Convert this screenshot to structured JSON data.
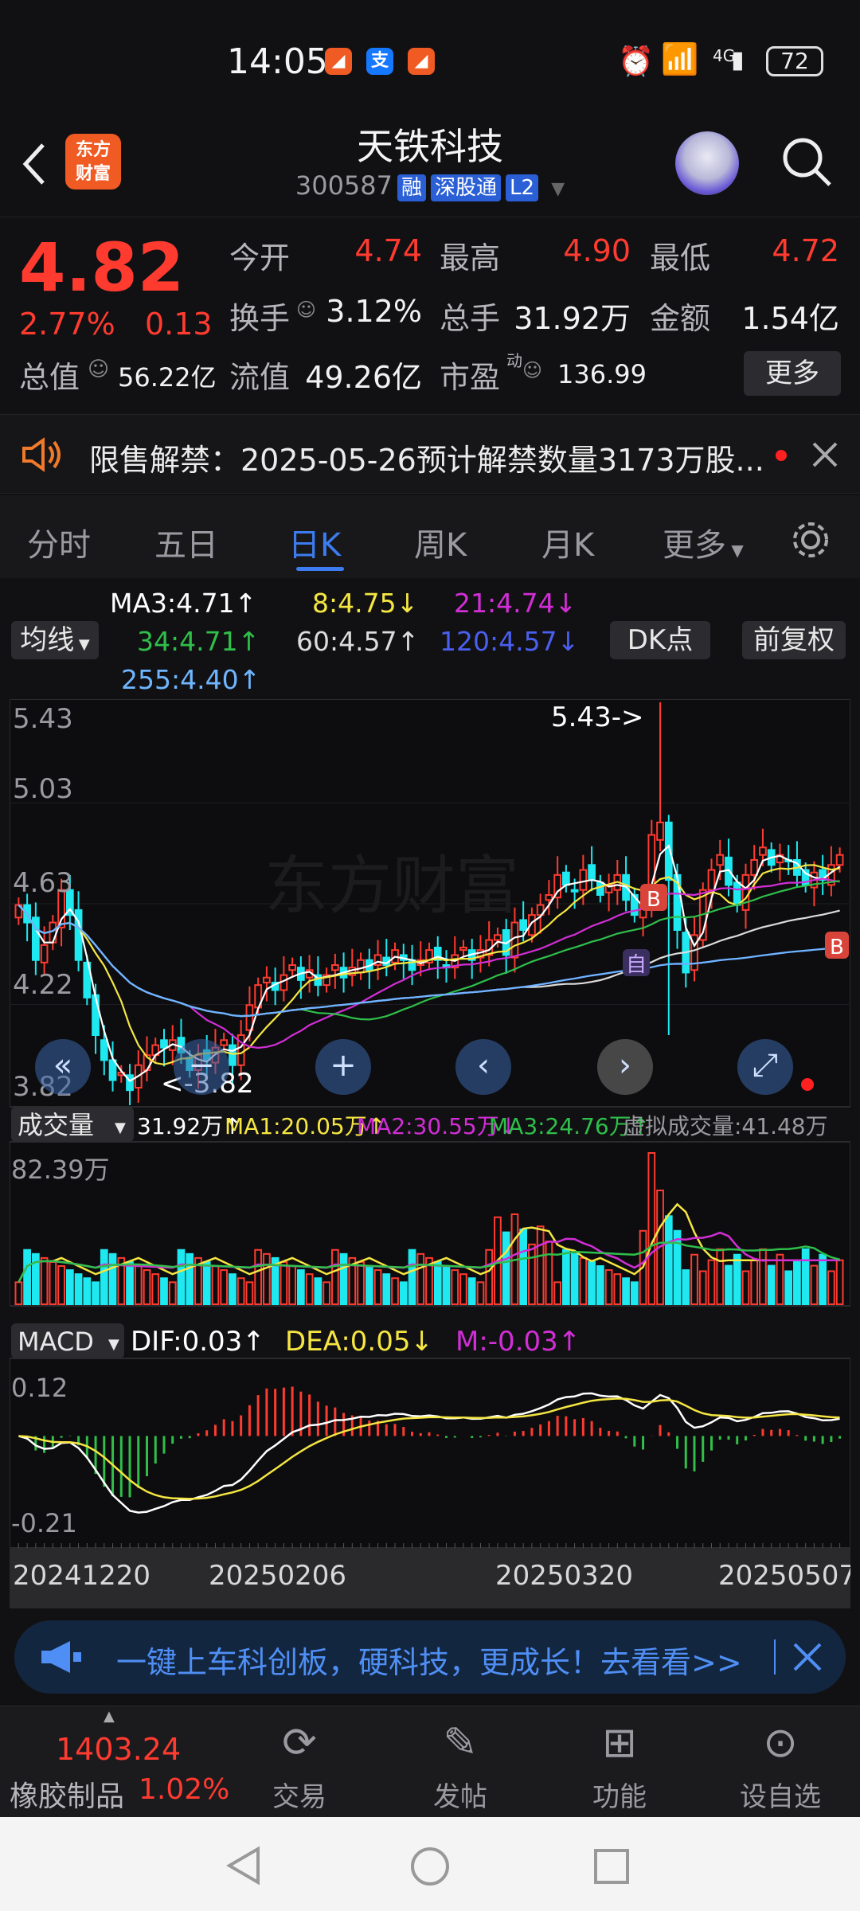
{
  "status_bar": {
    "time": "14:05",
    "battery": "72",
    "network": "4G"
  },
  "header": {
    "logo_line1": "东方",
    "logo_line2": "财富",
    "title": "天铁科技",
    "code": "300587",
    "tags": [
      "融",
      "深股通",
      "L2"
    ]
  },
  "quote": {
    "price": "4.82",
    "change_pct": "2.77%",
    "change": "0.13",
    "open_label": "今开",
    "open": "4.74",
    "high_label": "最高",
    "high": "4.90",
    "low_label": "最低",
    "low": "4.72",
    "turnover_label": "换手",
    "turnover": "3.12%",
    "volume_label": "总手",
    "volume": "31.92万",
    "amount_label": "金额",
    "amount": "1.54亿",
    "mcap_label": "总值",
    "mcap": "56.22亿",
    "float_label": "流值",
    "float_cap": "49.26亿",
    "pe_label": "市盈",
    "pe_sup": "动",
    "pe": "136.99",
    "more": "更多"
  },
  "notice": {
    "text": "限售解禁：2025-05-26预计解禁数量3173万股..."
  },
  "tabs": [
    "分时",
    "五日",
    "日K",
    "周K",
    "月K",
    "更多"
  ],
  "active_tab": 2,
  "ma_legend": {
    "ma3": "MA3:4.71↑",
    "ma8": "8:4.75↓",
    "ma21": "21:4.74↓",
    "ma34": "34:4.71↑",
    "ma60": "60:4.57↑",
    "ma120": "120:4.57↓",
    "ma255": "255:4.40↑",
    "selector": "均线",
    "dk": "DK点",
    "fq": "前复权"
  },
  "colors": {
    "up": "#ff3b30",
    "down": "#1ee8f0",
    "ma3": "#ffffff",
    "ma8": "#f5e642",
    "ma21": "#d22ed6",
    "ma34": "#2fbf4a",
    "ma60": "#dcdcdc",
    "ma120": "#4a5ff0",
    "ma255": "#6fb5ff",
    "accent": "#3d7cf0"
  },
  "kline": {
    "y_labels": [
      "5.43",
      "5.03",
      "4.63",
      "4.22",
      "3.82"
    ],
    "max_label": "5.43->",
    "min_label": "<-3.82",
    "markers": [
      "B",
      "B",
      "自"
    ]
  },
  "volume_panel": {
    "selector": "成交量",
    "v": "31.92万↑",
    "ma1": "MA1:20.05万↑",
    "ma2": "MA2:30.55万↓",
    "ma3": "MA3:24.76万↑",
    "virtual": "虚拟成交量:41.48万",
    "max": "82.39万"
  },
  "macd_panel": {
    "selector": "MACD",
    "dif": "DIF:0.03↑",
    "dea": "DEA:0.05↓",
    "m": "M:-0.03↑",
    "top": "0.12",
    "bottom": "-0.21"
  },
  "x_axis": [
    "20241220",
    "20250206",
    "20250320",
    "20250507"
  ],
  "promo": {
    "text": "一键上车科创板，硬科技，更成长！去看看>>"
  },
  "bottom_nav": {
    "index_value": "1403.24",
    "index_name": "橡胶制品",
    "index_pct": "1.02%",
    "items": [
      "交易",
      "发帖",
      "功能",
      "设自选"
    ]
  },
  "chart_data": {
    "type": "candlestick",
    "title": "天铁科技",
    "ylim": [
      3.82,
      5.43
    ],
    "x_ticks": [
      "20241220",
      "20250206",
      "20250320",
      "20250507"
    ],
    "close": [
      4.62,
      4.55,
      4.4,
      4.46,
      4.55,
      4.68,
      4.58,
      4.4,
      4.25,
      4.1,
      4.0,
      3.92,
      3.95,
      3.88,
      3.98,
      4.02,
      4.06,
      4.05,
      4.08,
      4.03,
      3.96,
      4.02,
      4.0,
      4.05,
      4.08,
      3.98,
      4.1,
      4.22,
      4.3,
      4.33,
      4.28,
      4.34,
      4.38,
      4.32,
      4.36,
      4.3,
      4.34,
      4.38,
      4.33,
      4.37,
      4.4,
      4.36,
      4.42,
      4.38,
      4.44,
      4.4,
      4.36,
      4.4,
      4.44,
      4.4,
      4.37,
      4.42,
      4.45,
      4.4,
      4.44,
      4.48,
      4.5,
      4.42,
      4.55,
      4.52,
      4.58,
      4.62,
      4.66,
      4.74,
      4.7,
      4.68,
      4.76,
      4.72,
      4.66,
      4.7,
      4.74,
      4.64,
      4.58,
      4.62,
      4.9,
      4.95,
      4.72,
      4.52,
      4.35,
      4.5,
      4.68,
      4.76,
      4.82,
      4.7,
      4.62,
      4.74,
      4.8,
      4.85,
      4.78,
      4.82,
      4.8,
      4.74,
      4.7,
      4.75,
      4.72,
      4.78,
      4.82
    ]
  }
}
